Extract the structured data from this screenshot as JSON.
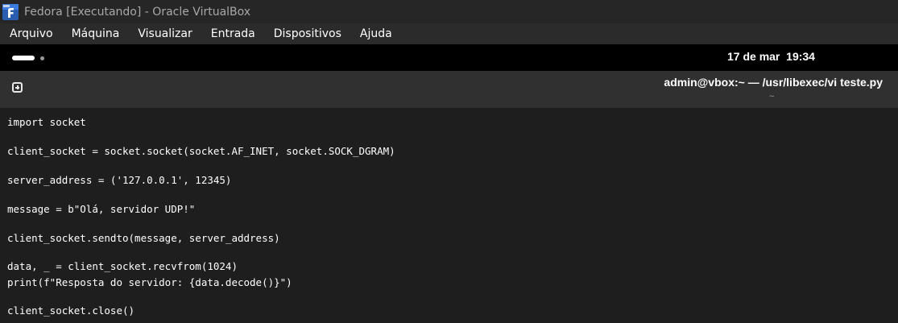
{
  "window": {
    "title": "Fedora [Executando] - Oracle VirtualBox"
  },
  "menubar": {
    "items": [
      "Arquivo",
      "Máquina",
      "Visualizar",
      "Entrada",
      "Dispositivos",
      "Ajuda"
    ]
  },
  "topbar": {
    "clock": "17 de mar  19:34"
  },
  "terminal": {
    "title": "admin@vbox:~ — /usr/libexec/vi teste.py",
    "subtitle": "~",
    "lines": [
      "import socket",
      "client_socket = socket.socket(socket.AF_INET, socket.SOCK_DGRAM)",
      "server_address = ('127.0.0.1', 12345)",
      "message = b\"Olá, servidor UDP!\"",
      "client_socket.sendto(message, server_address)",
      "data, _ = client_socket.recvfrom(1024)",
      "print(f\"Resposta do servidor: {data.decode()}\")",
      "client_socket.close()"
    ]
  },
  "icons": {
    "app": "virtualbox-app-icon",
    "activities": "activities-indicator-icon",
    "new_tab": "new-tab-icon"
  }
}
